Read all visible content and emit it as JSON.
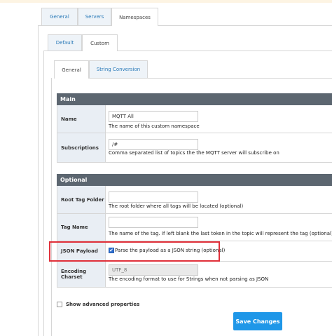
{
  "top_tabs": [
    {
      "label": "General",
      "active": false
    },
    {
      "label": "Servers",
      "active": false
    },
    {
      "label": "Namespaces",
      "active": true
    }
  ],
  "ns_tabs": [
    {
      "label": "Default",
      "active": false
    },
    {
      "label": "Custom",
      "active": true
    }
  ],
  "inner_tabs": [
    {
      "label": "General",
      "active": true
    },
    {
      "label": "String Conversion",
      "active": false
    }
  ],
  "main_section": {
    "title": "Main",
    "name": {
      "label": "Name",
      "value": "MQTT All",
      "hint": "The name of this custom namespace"
    },
    "subscriptions": {
      "label": "Subscriptions",
      "value": "/#",
      "hint": "Comma separated list of topics the the MQTT server will subscribe on"
    }
  },
  "optional_section": {
    "title": "Optional",
    "root_tag_folder": {
      "label": "Root Tag Folder",
      "value": "",
      "hint": "The root folder where all tags will be located (optional)"
    },
    "tag_name": {
      "label": "Tag Name",
      "value": "",
      "hint": "The name of the tag. If left blank the last token in the topic will represent the tag (optional)"
    },
    "json_payload": {
      "label": "JSON Payload",
      "checked": true,
      "hint": "Parse the payload as a JSON string (optional)"
    },
    "encoding_charset": {
      "label": "Encoding Charset",
      "value": "UTF_8",
      "hint": "The encoding format to use for Strings when not parsing as JSON"
    }
  },
  "advanced": {
    "label": "Show advanced properties",
    "checked": false
  },
  "save_button": {
    "label": "Save Changes"
  },
  "colors": {
    "highlight": "#e0303a",
    "accent": "#1f97e8",
    "section_header": "#5c6670",
    "link": "#2a7ab8"
  }
}
